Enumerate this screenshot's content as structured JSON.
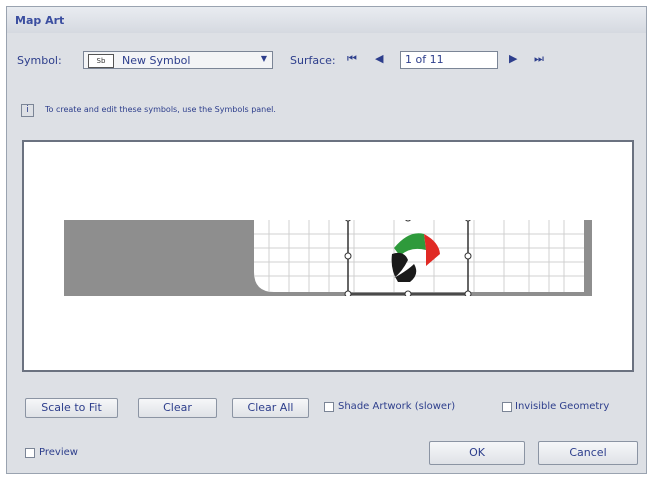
{
  "window": {
    "title": "Map Art"
  },
  "symbol": {
    "label": "Symbol:",
    "thumb_label": "Sb",
    "selected": "New Symbol"
  },
  "surface": {
    "label": "Surface:",
    "value": "1 of 11",
    "first_glyph": "⏮",
    "prev_glyph": "◀",
    "next_glyph": "▶",
    "last_glyph": "⏭"
  },
  "info": {
    "icon_glyph": "i",
    "text": "To create and edit these symbols, use the Symbols panel."
  },
  "buttons": {
    "scale_to_fit": "Scale to Fit",
    "clear": "Clear",
    "clear_all": "Clear All"
  },
  "checkboxes": {
    "shade_artwork": "Shade Artwork (slower)",
    "invisible_geometry": "Invisible Geometry",
    "preview": "Preview"
  },
  "footer": {
    "ok": "OK",
    "cancel": "Cancel"
  },
  "colors": {
    "accent": "#2d3e8c",
    "surface_gray": "#8e8e8e",
    "flag_green": "#2e9a3b",
    "flag_red": "#e02a24"
  }
}
